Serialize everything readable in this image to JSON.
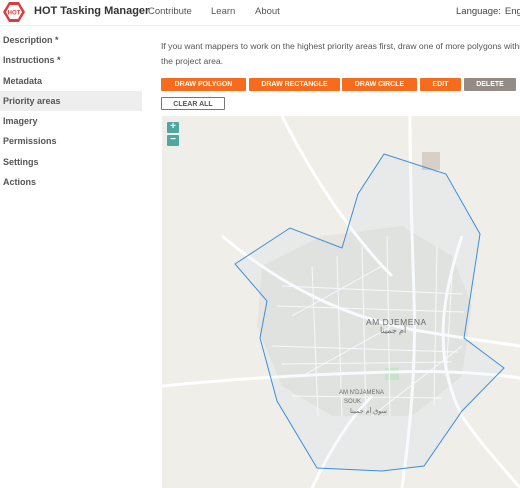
{
  "header": {
    "logo_text": "HOT",
    "brand": "HOT Tasking Manager",
    "nav": [
      "Contribute",
      "Learn",
      "About"
    ],
    "language_label": "Language:",
    "language_value": "English"
  },
  "sidebar": {
    "items": [
      {
        "label": "Description *"
      },
      {
        "label": "Instructions *"
      },
      {
        "label": "Metadata"
      },
      {
        "label": "Priority areas"
      },
      {
        "label": "Imagery"
      },
      {
        "label": "Permissions"
      },
      {
        "label": "Settings"
      },
      {
        "label": "Actions"
      }
    ]
  },
  "content": {
    "intro": "If you want mappers to work on the highest priority areas first, draw one of more polygons within the project area.",
    "buttons": {
      "draw_polygon": "Draw polygon",
      "draw_rectangle": "Draw rectangle",
      "draw_circle": "Draw circle",
      "edit": "Edit",
      "delete": "Delete",
      "clear_all": "Clear all"
    }
  },
  "map": {
    "zoom_in": "+",
    "zoom_out": "−",
    "city_label": "AM DJEMENA",
    "city_label_arabic": "أم جمينا",
    "district_label_1": "AM N'DJAMENA",
    "district_label_2": "SOUK",
    "district_label_arabic": "سوق أم جمينا",
    "colors": {
      "polygon": "#3c8ee0",
      "roads": "#ffffff",
      "base": "#efeee9",
      "urban": "#e7e5de",
      "accent": "#f76b1c"
    }
  }
}
